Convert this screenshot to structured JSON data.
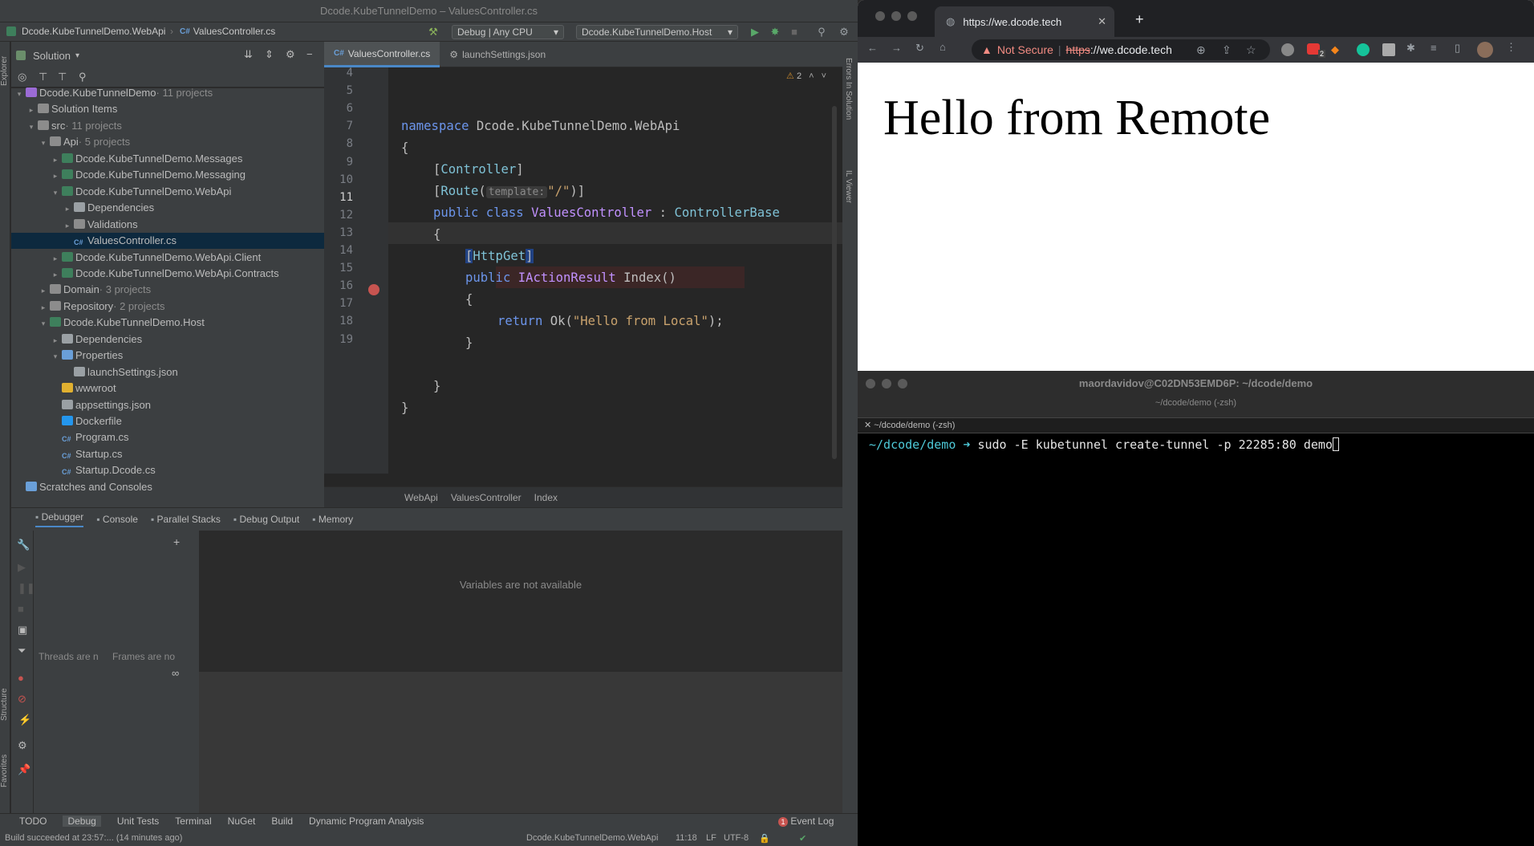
{
  "ide": {
    "window_title": "Dcode.KubeTunnelDemo – ValuesController.cs",
    "nav": {
      "project": "Dcode.KubeTunnelDemo.WebApi",
      "file": "ValuesController.cs",
      "config": "Debug | Any CPU",
      "run_target": "Dcode.KubeTunnelDemo.Host"
    },
    "left_strip": {
      "explorer": "Explorer",
      "structure": "Structure",
      "favorites": "Favorites"
    },
    "right_strip": {
      "errors": "Errors In Solution",
      "il": "IL Viewer"
    },
    "solution_header": "Solution",
    "tree": [
      {
        "label": "Dcode.KubeTunnelDemo",
        "sub": "· 11 projects",
        "depth": 0,
        "arrow": "▾",
        "icon": "solution"
      },
      {
        "label": "Solution Items",
        "sub": "",
        "depth": 1,
        "arrow": "▸",
        "icon": "folder"
      },
      {
        "label": "src",
        "sub": "· 11 projects",
        "depth": 1,
        "arrow": "▾",
        "icon": "folder"
      },
      {
        "label": "Api",
        "sub": "· 5 projects",
        "depth": 2,
        "arrow": "▾",
        "icon": "folder"
      },
      {
        "label": "Dcode.KubeTunnelDemo.Messages",
        "sub": "",
        "depth": 3,
        "arrow": "▸",
        "icon": "project"
      },
      {
        "label": "Dcode.KubeTunnelDemo.Messaging",
        "sub": "",
        "depth": 3,
        "arrow": "▸",
        "icon": "project"
      },
      {
        "label": "Dcode.KubeTunnelDemo.WebApi",
        "sub": "",
        "depth": 3,
        "arrow": "▾",
        "icon": "project"
      },
      {
        "label": "Dependencies",
        "sub": "",
        "depth": 4,
        "arrow": "▸",
        "icon": "deps"
      },
      {
        "label": "Validations",
        "sub": "",
        "depth": 4,
        "arrow": "▸",
        "icon": "folder"
      },
      {
        "label": "ValuesController.cs",
        "sub": "",
        "depth": 4,
        "arrow": "",
        "icon": "cs",
        "selected": true
      },
      {
        "label": "Dcode.KubeTunnelDemo.WebApi.Client",
        "sub": "",
        "depth": 3,
        "arrow": "▸",
        "icon": "project"
      },
      {
        "label": "Dcode.KubeTunnelDemo.WebApi.Contracts",
        "sub": "",
        "depth": 3,
        "arrow": "▸",
        "icon": "project"
      },
      {
        "label": "Domain",
        "sub": "· 3 projects",
        "depth": 2,
        "arrow": "▸",
        "icon": "folder"
      },
      {
        "label": "Repository",
        "sub": "· 2 projects",
        "depth": 2,
        "arrow": "▸",
        "icon": "folder"
      },
      {
        "label": "Dcode.KubeTunnelDemo.Host",
        "sub": "",
        "depth": 2,
        "arrow": "▾",
        "icon": "project"
      },
      {
        "label": "Dependencies",
        "sub": "",
        "depth": 3,
        "arrow": "▸",
        "icon": "deps"
      },
      {
        "label": "Properties",
        "sub": "",
        "depth": 3,
        "arrow": "▾",
        "icon": "props"
      },
      {
        "label": "launchSettings.json",
        "sub": "",
        "depth": 4,
        "arrow": "",
        "icon": "json"
      },
      {
        "label": "wwwroot",
        "sub": "",
        "depth": 3,
        "arrow": "",
        "icon": "warn"
      },
      {
        "label": "appsettings.json",
        "sub": "",
        "depth": 3,
        "arrow": "",
        "icon": "json"
      },
      {
        "label": "Dockerfile",
        "sub": "",
        "depth": 3,
        "arrow": "",
        "icon": "docker"
      },
      {
        "label": "Program.cs",
        "sub": "",
        "depth": 3,
        "arrow": "",
        "icon": "cs"
      },
      {
        "label": "Startup.cs",
        "sub": "",
        "depth": 3,
        "arrow": "",
        "icon": "cs"
      },
      {
        "label": "Startup.Dcode.cs",
        "sub": "",
        "depth": 3,
        "arrow": "",
        "icon": "cs"
      },
      {
        "label": "Scratches and Consoles",
        "sub": "",
        "depth": 0,
        "arrow": "",
        "icon": "scratch"
      }
    ],
    "tabs": [
      {
        "label": "ValuesController.cs",
        "active": true
      },
      {
        "label": "launchSettings.json",
        "active": false
      }
    ],
    "warnings": "2",
    "line_numbers": [
      "4",
      "5",
      "6",
      "7",
      "8",
      "9",
      "10",
      "11",
      "12",
      "13",
      "14",
      "15",
      "16",
      "17",
      "18",
      "19"
    ],
    "code": {
      "l5_kw": "namespace",
      "l5_ns": " Dcode.KubeTunnelDemo.WebApi",
      "l6": "{",
      "l7_a": "[",
      "l7_b": "Controller",
      "l7_c": "]",
      "l8_a": "[",
      "l8_b": "Route",
      "l8_c": "(",
      "l8_hint": "template:",
      "l8_d": "\"/\"",
      "l8_e": ")]",
      "l9_a": "public class ",
      "l9_b": "ValuesController",
      "l9_c": " : ",
      "l9_d": "ControllerBase",
      "l10": "{",
      "l11_a": "[",
      "l11_b": "HttpGet",
      "l11_c": "]",
      "l12_a": "public ",
      "l12_b": "IActionResult",
      "l12_c": " Index()",
      "l13": "{",
      "l14_a": "return ",
      "l14_b": "Ok(",
      "l14_c": "\"Hello from Local\"",
      "l14_d": ");",
      "l15": "}",
      "l17": "}",
      "l18": "}"
    },
    "breadcrumb": [
      "WebApi",
      "ValuesController",
      "Index"
    ],
    "debug_tabs": [
      "Debugger",
      "Console",
      "Parallel Stacks",
      "Debug Output",
      "Memory"
    ],
    "vars_empty": "Variables are not available",
    "threads_text": "Threads are n",
    "frames_text": "Frames are no",
    "bottom_tools": [
      "TODO",
      "Debug",
      "Unit Tests",
      "Terminal",
      "NuGet",
      "Build",
      "Dynamic Program Analysis"
    ],
    "event_log": "Event Log",
    "event_count": "1",
    "status": {
      "build": "Build succeeded at 23:57:... (14 minutes ago)",
      "project": "Dcode.KubeTunnelDemo.WebApi",
      "pos": "11:18",
      "eol": "LF",
      "enc": "UTF-8"
    }
  },
  "browser": {
    "tab_title": "https://we.dcode.tech",
    "not_secure": "Not Secure",
    "url_scheme": "https",
    "url_rest": "://we.dcode.tech",
    "ext_badge": "2",
    "heading": "Hello from Remote"
  },
  "terminal": {
    "title": "maordavidov@C02DN53EMD6P: ~/dcode/demo",
    "subtitle": "~/dcode/demo (-zsh)",
    "tab": "~/dcode/demo (-zsh)",
    "prompt_path": "~/dcode/demo",
    "prompt_arrow": " ➜ ",
    "command": "sudo -E kubetunnel create-tunnel -p 22285:80 demo"
  },
  "colors": {
    "accent": "#4a88c7",
    "breakpoint": "#c75450",
    "terminal_path": "#4ec9d8"
  }
}
